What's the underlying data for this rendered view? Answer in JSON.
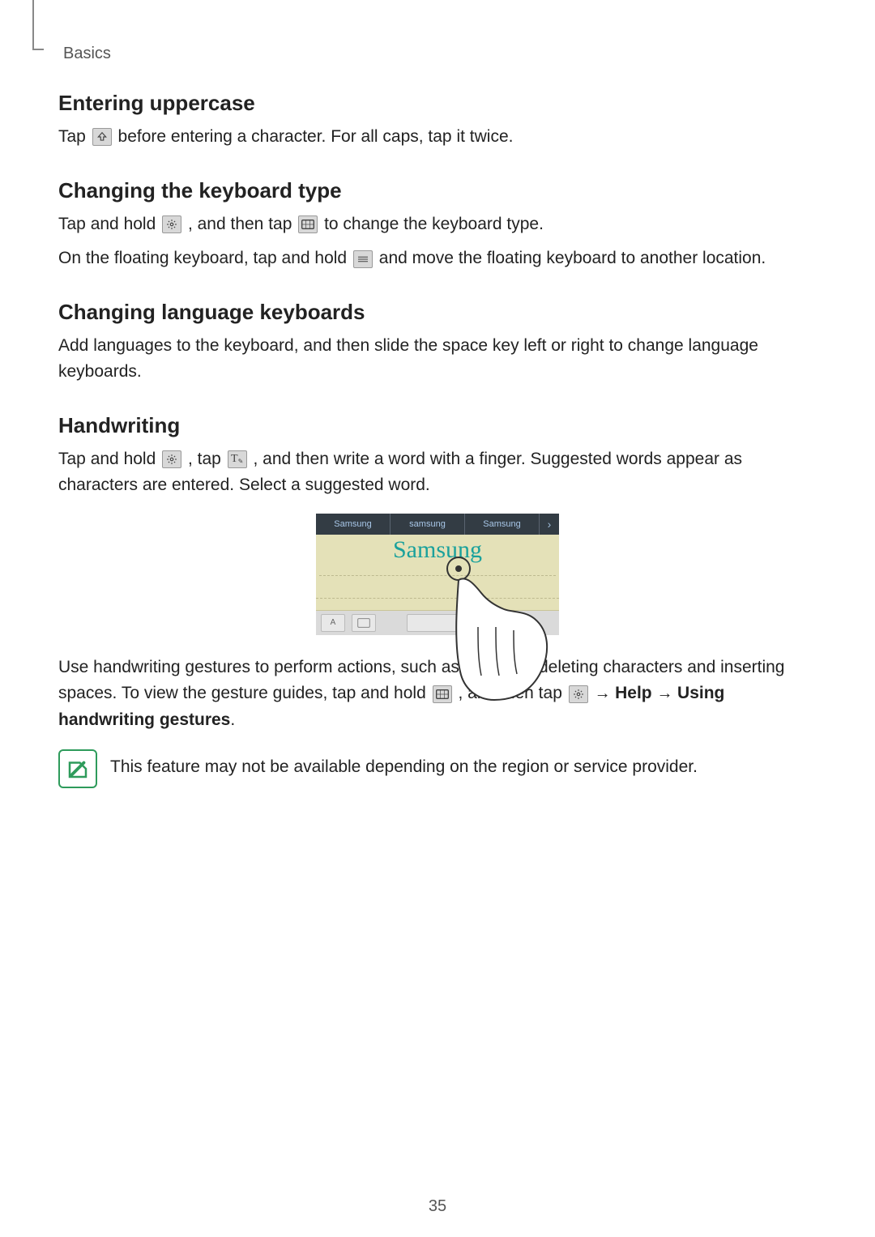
{
  "header": {
    "section": "Basics"
  },
  "sections": {
    "uppercase": {
      "title": "Entering uppercase",
      "para_pre": "Tap ",
      "para_post": " before entering a character. For all caps, tap it twice."
    },
    "kbtype": {
      "title": "Changing the keyboard type",
      "p1_pre": "Tap and hold ",
      "p1_mid": ", and then tap ",
      "p1_post": " to change the keyboard type.",
      "p2_pre": "On the floating keyboard, tap and hold ",
      "p2_post": " and move the floating keyboard to another location."
    },
    "lang": {
      "title": "Changing language keyboards",
      "para": "Add languages to the keyboard, and then slide the space key left or right to change language keyboards."
    },
    "handwriting": {
      "title": "Handwriting",
      "p1_pre": "Tap and hold ",
      "p1_mid": ", tap ",
      "p1_post": ", and then write a word with a finger. Suggested words appear as characters are entered. Select a suggested word.",
      "p2_pre": "Use handwriting gestures to perform actions, such as editing or deleting characters and inserting spaces. To view the gesture guides, tap and hold ",
      "p2_mid": ", and then tap ",
      "p2_arrow1": " → ",
      "p2_help": "Help",
      "p2_arrow2": " → ",
      "p2_tail": "Using handwriting gestures",
      "p2_period": ".",
      "note": "This feature may not be available depending on the region or service provider."
    }
  },
  "illustration": {
    "suggestions": [
      "Samsung",
      "samsung",
      "Samsung"
    ],
    "handwriting_text": "Samsung"
  },
  "page_number": "35"
}
